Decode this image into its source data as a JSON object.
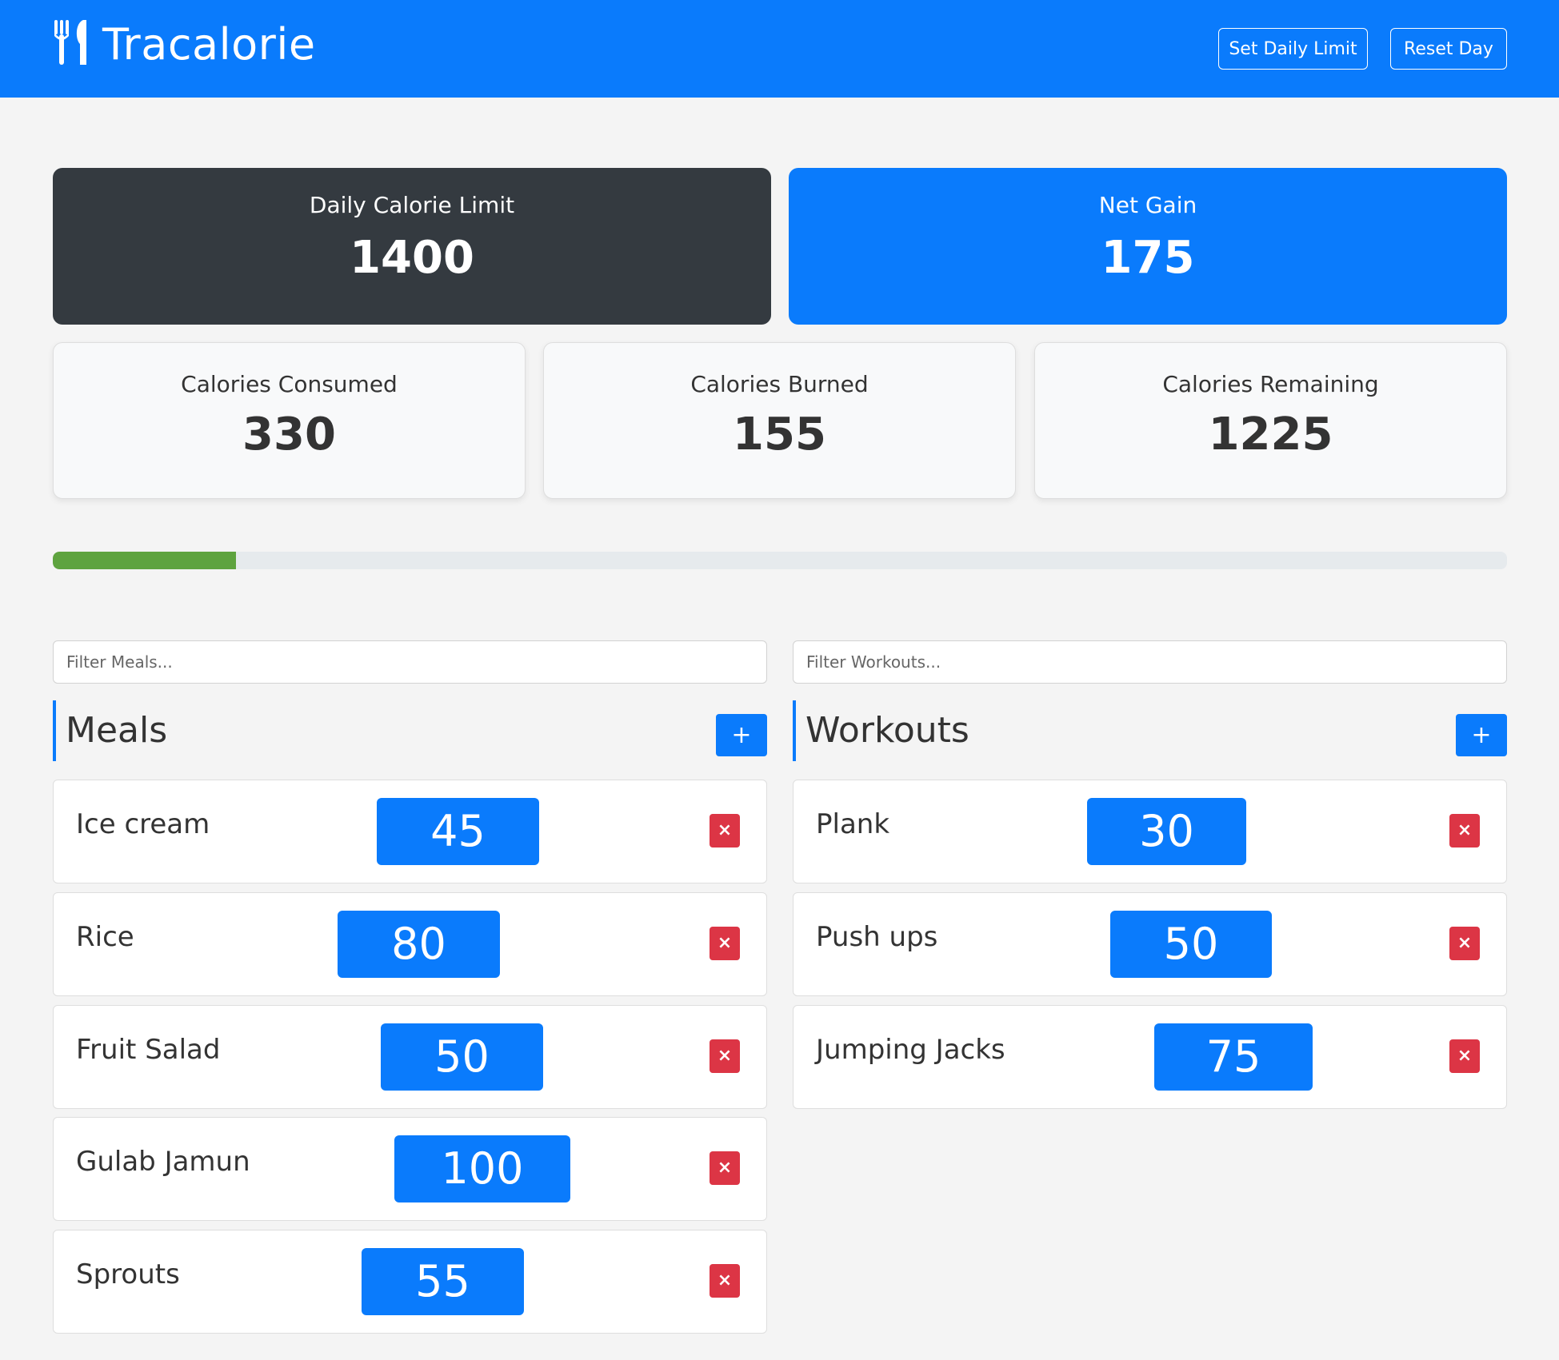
{
  "brand": {
    "title": "Tracalorie",
    "icon": "utensils-icon"
  },
  "nav": {
    "set_limit_label": "Set Daily Limit",
    "reset_label": "Reset Day"
  },
  "stats": {
    "limit": {
      "label": "Daily Calorie Limit",
      "value": "1400"
    },
    "net": {
      "label": "Net Gain",
      "value": "175"
    },
    "consumed": {
      "label": "Calories Consumed",
      "value": "330"
    },
    "burned": {
      "label": "Calories Burned",
      "value": "155"
    },
    "remaining": {
      "label": "Calories Remaining",
      "value": "1225"
    }
  },
  "progress": {
    "fraction": 0.126,
    "color": "#5ea33f"
  },
  "filters": {
    "meals_placeholder": "Filter Meals...",
    "workouts_placeholder": "Filter Workouts..."
  },
  "meals": {
    "title": "Meals",
    "add_label": "+",
    "items": [
      {
        "name": "Ice cream",
        "calories": "45"
      },
      {
        "name": "Rice",
        "calories": "80"
      },
      {
        "name": "Fruit Salad",
        "calories": "50"
      },
      {
        "name": "Gulab Jamun",
        "calories": "100"
      },
      {
        "name": "Sprouts",
        "calories": "55"
      }
    ]
  },
  "workouts": {
    "title": "Workouts",
    "add_label": "+",
    "items": [
      {
        "name": "Plank",
        "calories": "30"
      },
      {
        "name": "Push ups",
        "calories": "50"
      },
      {
        "name": "Jumping Jacks",
        "calories": "75"
      }
    ]
  },
  "delete_label": "×",
  "colors": {
    "primary": "#0a7bfc",
    "dark": "#343a40",
    "danger": "#dc3545",
    "success": "#5ea33f"
  }
}
